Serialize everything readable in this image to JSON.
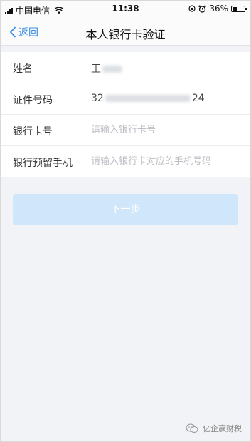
{
  "status_bar": {
    "carrier": "中国电信",
    "time": "11:38",
    "battery_percent": "36%",
    "battery_level": 0.36
  },
  "nav": {
    "back_label": "返回",
    "title": "本人银行卡验证"
  },
  "form": {
    "name_label": "姓名",
    "name_value_prefix": "王",
    "id_label": "证件号码",
    "id_value_prefix": "32",
    "id_value_suffix": "24",
    "card_label": "银行卡号",
    "card_placeholder": "请输入银行卡号",
    "phone_label": "银行预留手机",
    "phone_placeholder": "请输入银行卡对应的手机号码"
  },
  "next_button": {
    "label": "下一步"
  },
  "watermark": {
    "text": "亿企赢财税"
  },
  "colors": {
    "accent": "#3b8ee3",
    "button_disabled": "#cfe6fb",
    "background": "#f2f3f7"
  }
}
